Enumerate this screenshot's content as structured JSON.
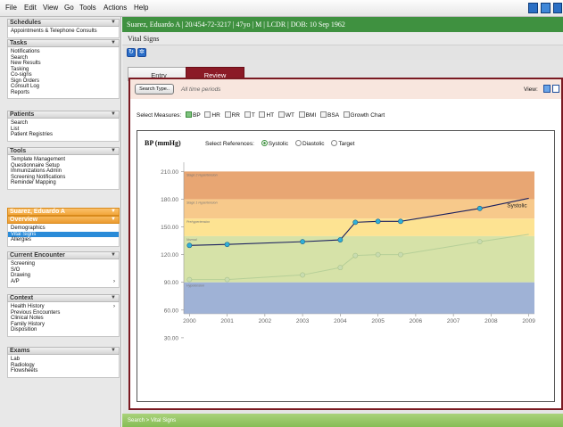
{
  "menu": [
    "File",
    "Edit",
    "View",
    "Go",
    "Tools",
    "Actions",
    "Help"
  ],
  "sidebar": {
    "schedules": {
      "title": "Schedules",
      "items": [
        "Appointments & Telephone Consults"
      ]
    },
    "tasks": {
      "title": "Tasks",
      "items": [
        "Notifications",
        "Search",
        "New Results",
        "Tasking",
        "Co-signs",
        "Sign Orders",
        "Consult Log",
        "Reports"
      ]
    },
    "patients": {
      "title": "Patients",
      "items": [
        "Search",
        "List",
        "Patient Registries"
      ]
    },
    "tools": {
      "title": "Tools",
      "items": [
        "Template Management",
        "Questionnaire Setup",
        "Immunizations Admin",
        "Screening Notifications",
        "Reminder Mapping"
      ]
    },
    "patient_name": "Suarez, Eduardo A",
    "overview": {
      "title": "Overview",
      "items": [
        "Demographics",
        "Vital Signs",
        "Allergies"
      ],
      "selected": "Vital Signs"
    },
    "current_encounter": {
      "title": "Current Encounter",
      "items": [
        "Screening",
        "S/O",
        "Drawing",
        "A/P"
      ]
    },
    "context": {
      "title": "Context",
      "items": [
        "Health History",
        "Previous Encounters",
        "Clinical Notes",
        "Family History",
        "Disposition"
      ]
    },
    "exams": {
      "title": "Exams",
      "items": [
        "Lab",
        "Radiology",
        "Flowsheets"
      ]
    }
  },
  "patient_bar": "Suarez, Eduardo A | 20/454-72-3217 | 47yo | M | LCDR | DOB: 10 Sep 1962",
  "page_title": "Vital Signs",
  "tabs": {
    "entry": "Entry",
    "review": "Review"
  },
  "search": {
    "button": "Search Type..",
    "period": "All time periods",
    "view_label": "View:"
  },
  "measures": {
    "label": "Select Measures:",
    "options": [
      "BP",
      "HR",
      "RR",
      "T",
      "HT",
      "WT",
      "BMI",
      "BSA",
      "Growth Chart"
    ],
    "checked": "BP"
  },
  "chart_title": "BP (mmHg)",
  "references": {
    "label": "Select References:",
    "options": [
      "Systolic",
      "Diastolic",
      "Target"
    ],
    "selected": "Systolic"
  },
  "status_bar": "Search > Vital Signs",
  "colors": {
    "patient_bar": "#3f9140",
    "tab_active": "#8b1a26",
    "systolic_line": "#1a1f5e",
    "diastolic_line": "#b6cf98"
  },
  "chart_data": {
    "type": "line",
    "x": [
      2000,
      2001,
      2002,
      2003,
      2004,
      2005,
      2006,
      2007,
      2008,
      2009
    ],
    "yticks": [
      "210.00",
      "180.00",
      "150.00",
      "120.00",
      "90.00",
      "60.00",
      "30.00"
    ],
    "ylim": [
      0,
      220
    ],
    "bands": [
      {
        "label": "Stage 2 Hypertension",
        "from": 180,
        "to": 210,
        "color": "#e8a673"
      },
      {
        "label": "Stage 1 Hypertension",
        "from": 159,
        "to": 180,
        "color": "#f7c98b"
      },
      {
        "label": "Prehypertension",
        "from": 140,
        "to": 159,
        "color": "#fde392"
      },
      {
        "label": "Normal",
        "from": 90,
        "to": 140,
        "color": "#d6e2a8"
      },
      {
        "label": "Hypotension",
        "from": 0,
        "to": 90,
        "color": "#9fb2d6"
      }
    ],
    "series": [
      {
        "name": "Systolic",
        "points": [
          [
            2000,
            130
          ],
          [
            2001,
            131
          ],
          [
            2003,
            134
          ],
          [
            2004,
            136
          ],
          [
            2004.4,
            155
          ],
          [
            2005,
            156
          ],
          [
            2005.6,
            156
          ],
          [
            2007.7,
            170
          ],
          [
            2009,
            181
          ]
        ]
      },
      {
        "points": [
          [
            2000,
            93
          ],
          [
            2001,
            93
          ],
          [
            2003,
            98
          ],
          [
            2004,
            106
          ],
          [
            2004.4,
            119
          ],
          [
            2005,
            120
          ],
          [
            2005.6,
            120
          ],
          [
            2007.7,
            134
          ],
          [
            2009,
            142
          ]
        ]
      }
    ]
  }
}
